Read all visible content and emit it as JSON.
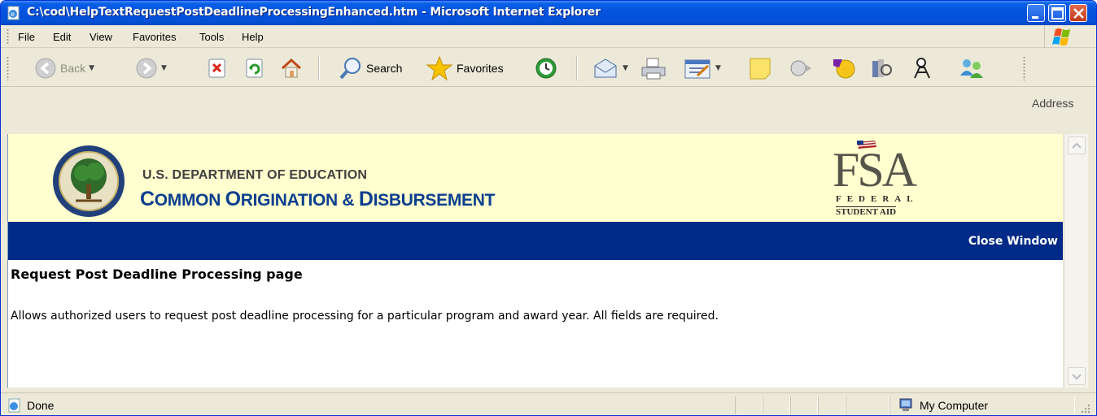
{
  "window": {
    "title": "C:\\cod\\HelpTextRequestPostDeadlineProcessingEnhanced.htm - Microsoft Internet Explorer"
  },
  "menu": {
    "items": [
      "File",
      "Edit",
      "View",
      "Favorites",
      "Tools",
      "Help"
    ]
  },
  "toolbar": {
    "back_label": "Back",
    "search_label": "Search",
    "favorites_label": "Favorites",
    "address_label": "Address"
  },
  "banner": {
    "dept_line": "U.S. DEPARTMENT OF EDUCATION",
    "app_line_1": "C",
    "app_line_2": "OMMON ",
    "app_line_3": "O",
    "app_line_4": "RIGINATION & ",
    "app_line_5": "D",
    "app_line_6": "ISBURSEMENT",
    "fsa_logo_text": "FSA",
    "fsa_federal": "FEDERAL",
    "fsa_student_aid": "STUDENT AID"
  },
  "nav": {
    "close_window": "Close Window"
  },
  "page": {
    "heading": "Request Post Deadline Processing page",
    "description": "Allows authorized users to request post deadline processing for a particular program and award year. All fields are required."
  },
  "status": {
    "text": "Done",
    "zone": "My Computer"
  },
  "colors": {
    "titlebar": "#0453df",
    "banner_bg": "#ffffcf",
    "navbar": "#002a87",
    "cod_blue": "#0b3f8e"
  }
}
